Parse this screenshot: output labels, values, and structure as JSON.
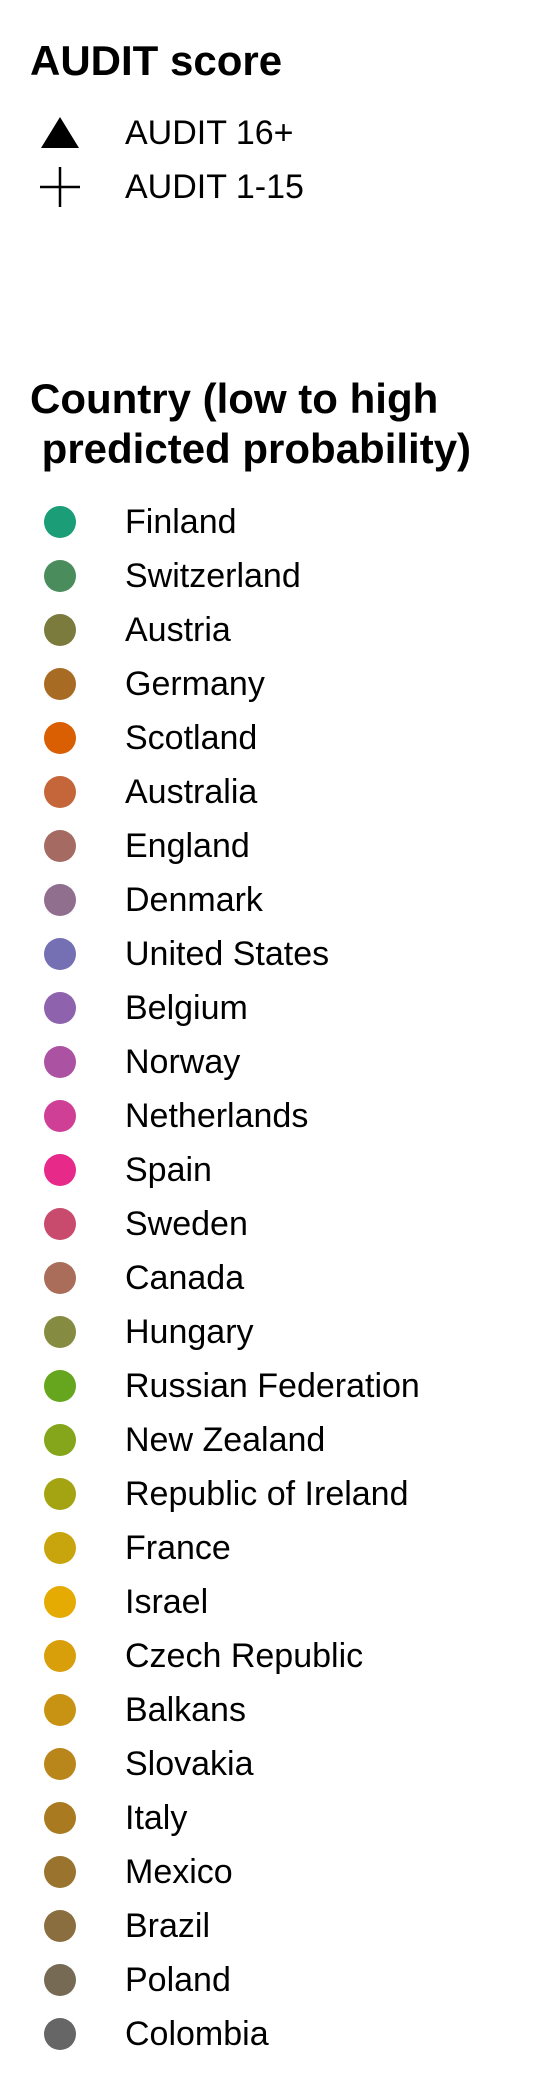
{
  "chart_data": {
    "type": "scatter",
    "legends": [
      {
        "title": "AUDIT score",
        "aesthetic": "shape",
        "entries": [
          {
            "label": "AUDIT 16+",
            "shape": "triangle"
          },
          {
            "label": "AUDIT 1-15",
            "shape": "cross"
          }
        ]
      },
      {
        "title": "Country (low to high\n predicted probability)",
        "aesthetic": "color",
        "entries": [
          {
            "label": "Finland",
            "color": "#1b9e77"
          },
          {
            "label": "Switzerland",
            "color": "#4a8c5c"
          },
          {
            "label": "Austria",
            "color": "#7a7b3c"
          },
          {
            "label": "Germany",
            "color": "#a86b24"
          },
          {
            "label": "Scotland",
            "color": "#d95f02"
          },
          {
            "label": "Australia",
            "color": "#c4663a"
          },
          {
            "label": "England",
            "color": "#a56b62"
          },
          {
            "label": "Denmark",
            "color": "#8f6e8e"
          },
          {
            "label": "United States",
            "color": "#7570b3"
          },
          {
            "label": "Belgium",
            "color": "#8f62ad"
          },
          {
            "label": "Norway",
            "color": "#ab52a2"
          },
          {
            "label": "Netherlands",
            "color": "#cf3f95"
          },
          {
            "label": "Spain",
            "color": "#e7298a"
          },
          {
            "label": "Sweden",
            "color": "#c84a6c"
          },
          {
            "label": "Canada",
            "color": "#a96d5a"
          },
          {
            "label": "Hungary",
            "color": "#868b42"
          },
          {
            "label": "Russian Federation",
            "color": "#66a61e"
          },
          {
            "label": "New Zealand",
            "color": "#85a51a"
          },
          {
            "label": "Republic of Ireland",
            "color": "#a4a413"
          },
          {
            "label": "France",
            "color": "#c8a50c"
          },
          {
            "label": "Israel",
            "color": "#e6ab02"
          },
          {
            "label": "Czech Republic",
            "color": "#d99f0b"
          },
          {
            "label": "Balkans",
            "color": "#c89313"
          },
          {
            "label": "Slovakia",
            "color": "#b8861a"
          },
          {
            "label": "Italy",
            "color": "#a97a20"
          },
          {
            "label": "Mexico",
            "color": "#9a742f"
          },
          {
            "label": "Brazil",
            "color": "#8a6e40"
          },
          {
            "label": "Poland",
            "color": "#776a55"
          },
          {
            "label": "Colombia",
            "color": "#666666"
          }
        ]
      }
    ]
  }
}
